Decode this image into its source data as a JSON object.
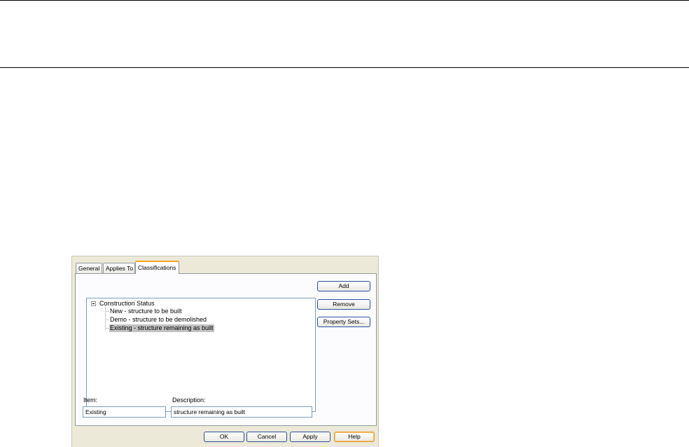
{
  "dialog": {
    "tabs": [
      "General",
      "Applies To",
      "Classifications"
    ],
    "active_tab": "Classifications",
    "tree": {
      "root": "Construction Status",
      "expander": "minus",
      "items": [
        "New - structure to be built",
        "Demo - structure to be demolished",
        "Existing - structure remaining as built"
      ],
      "selected_index": 2
    },
    "buttons": {
      "add": "Add",
      "remove": "Remove",
      "property_sets": "Property Sets..."
    },
    "item_label": "Item:",
    "item_value": "Existing",
    "description_label": "Description:",
    "description_value": "structure remaining as built",
    "footer": {
      "ok": "OK",
      "cancel": "Cancel",
      "apply": "Apply",
      "help": "Help"
    }
  },
  "colors": {
    "dialog_bg": "#ece9d8",
    "panel_bg": "#fcfcfe",
    "selection_bg": "#c2c2c2",
    "active_tab_accent": "#f5a623",
    "button_border": "#2d4f9e"
  }
}
